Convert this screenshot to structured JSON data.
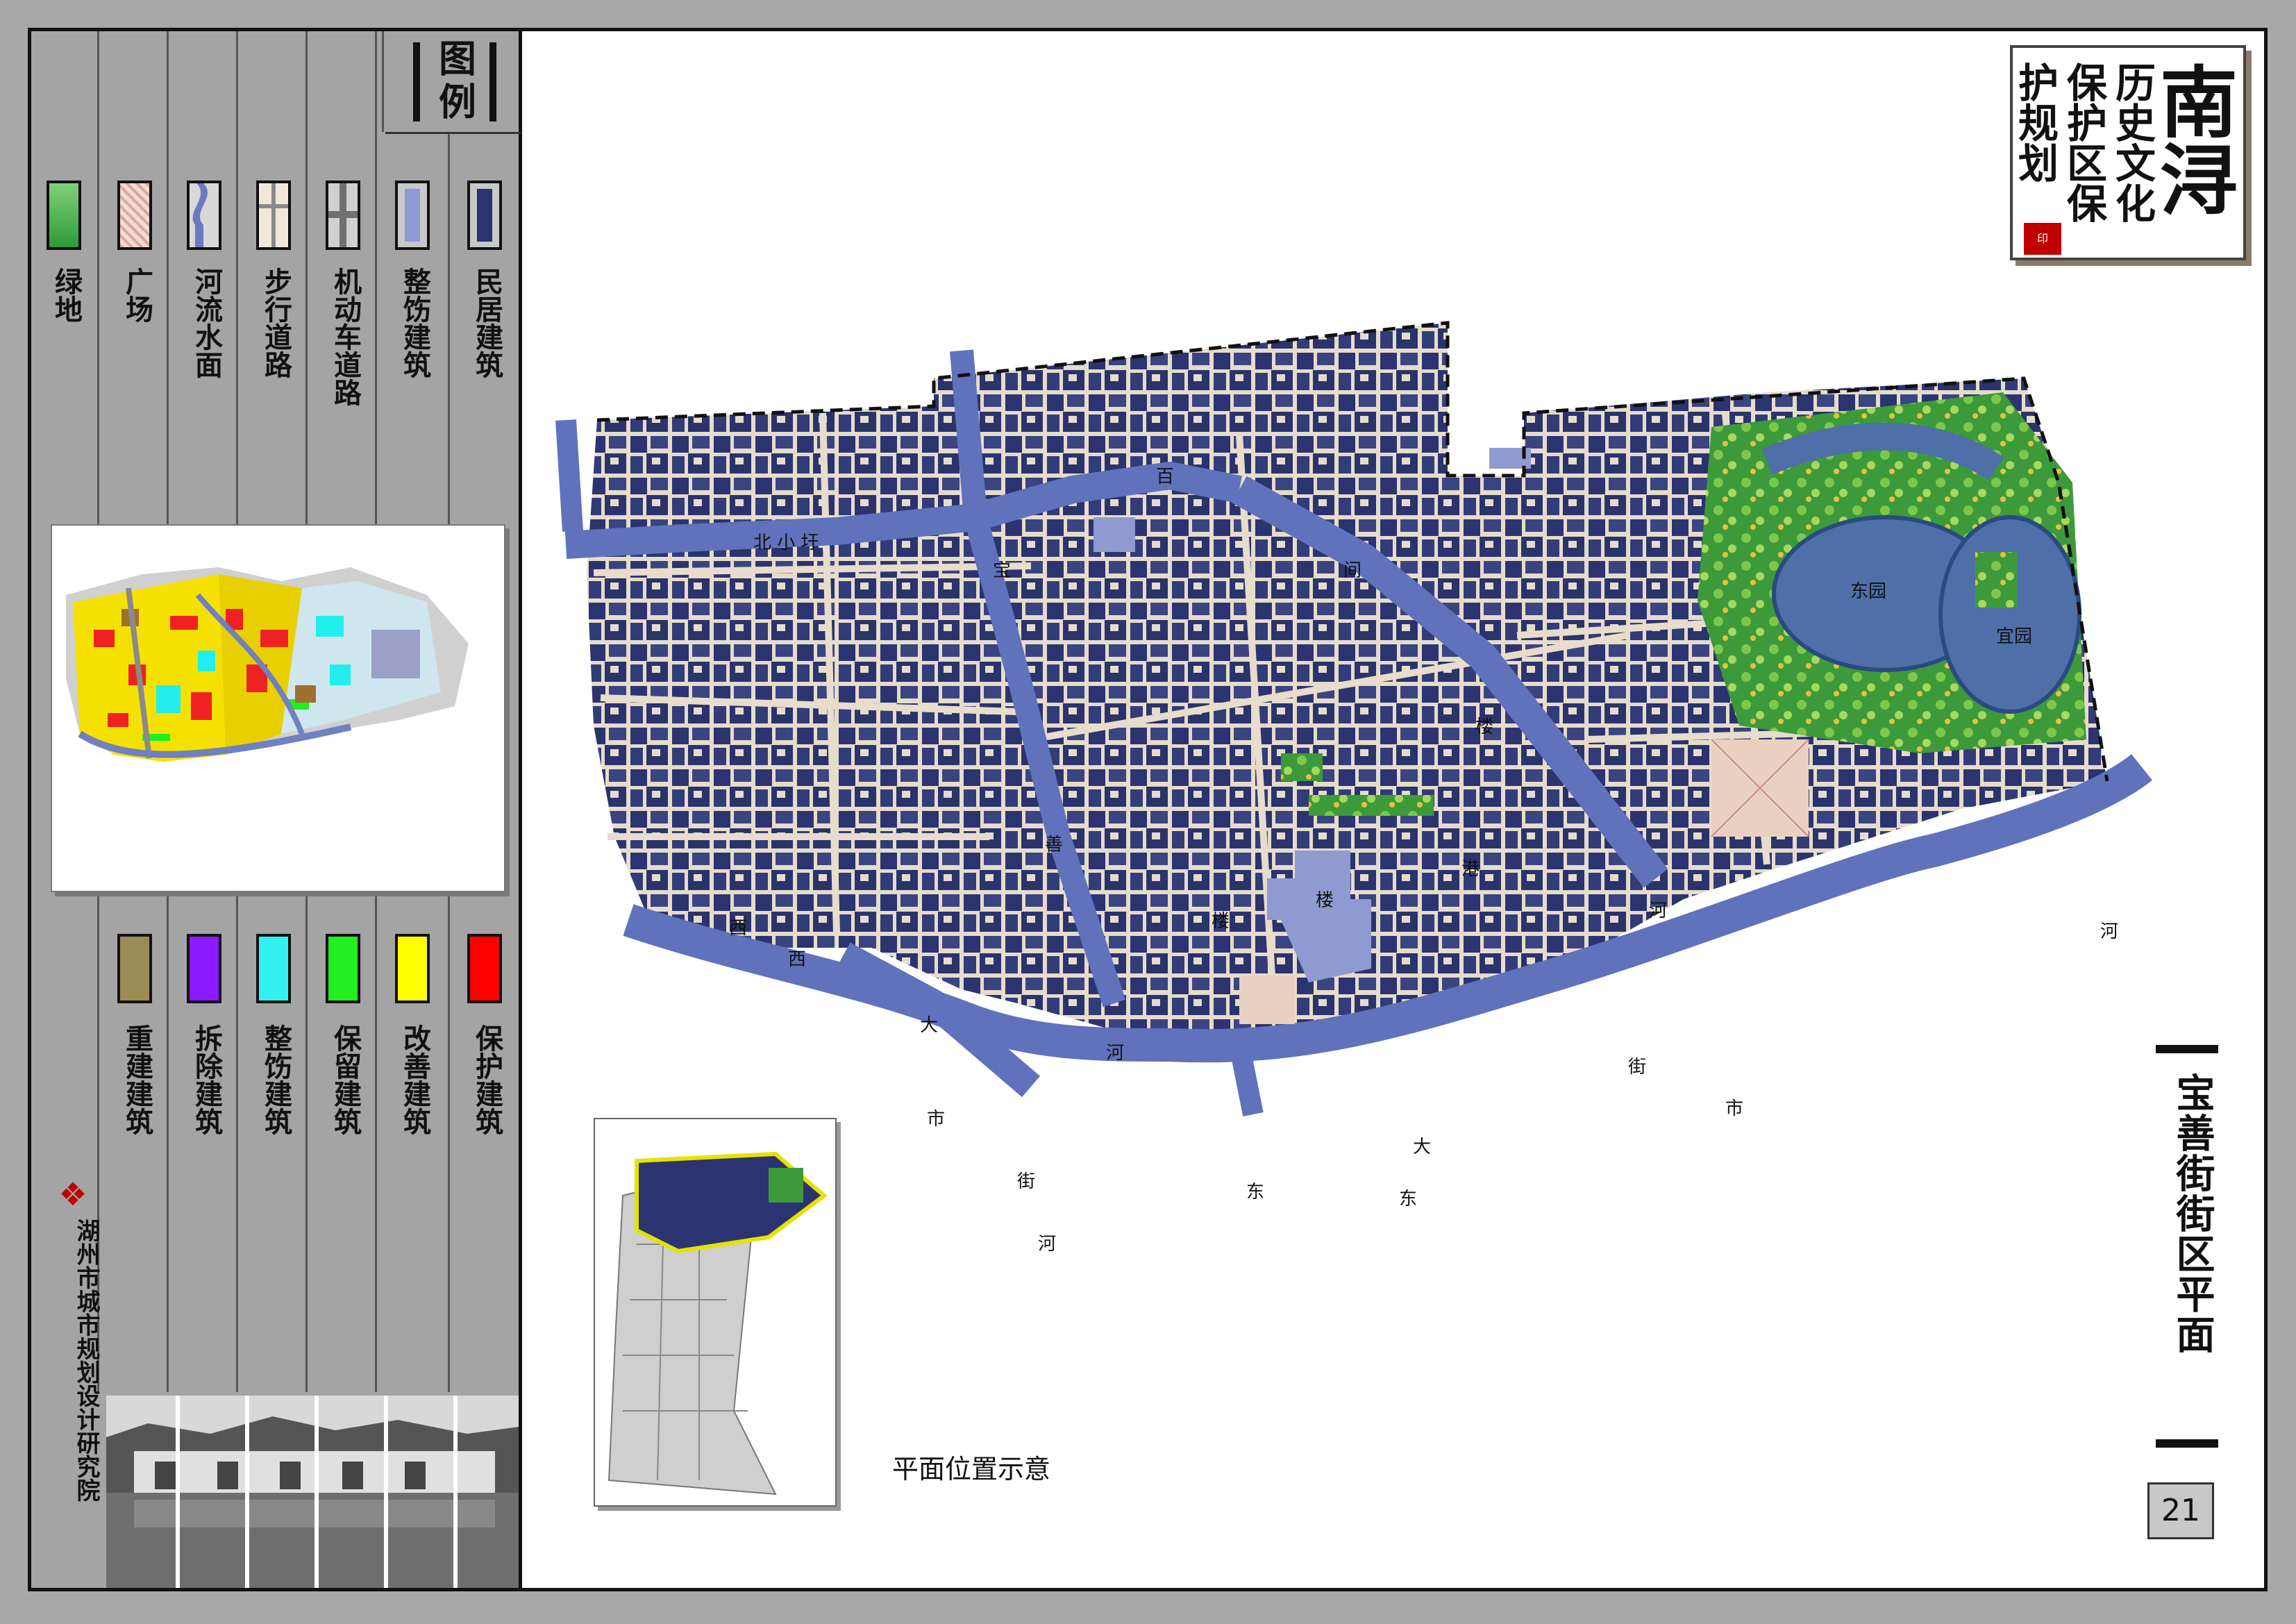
{
  "legend": {
    "title": "图例",
    "top_items": [
      {
        "label": "绿地",
        "color": "#3fa84a",
        "icon": "green-space-swatch"
      },
      {
        "label": "广场",
        "color": "#e9c8b8",
        "icon": "plaza-swatch"
      },
      {
        "label": "河流水面",
        "color": "#6a7bc0",
        "icon": "river-swatch"
      },
      {
        "label": "步行道路",
        "color": "#e8dccb",
        "icon": "walkway-swatch"
      },
      {
        "label": "机动车道路",
        "color": "#9a9a9a",
        "icon": "road-swatch"
      },
      {
        "label": "整饬建筑",
        "color": "#8e9ad0",
        "icon": "renovated-building-swatch"
      },
      {
        "label": "民居建筑",
        "color": "#2b3470",
        "icon": "residential-building-swatch"
      }
    ],
    "bottom_items": [
      {
        "label": "重建建筑",
        "color": "#9c8b55"
      },
      {
        "label": "拆除建筑",
        "color": "#8b1aff"
      },
      {
        "label": "整饬建筑",
        "color": "#33f0f0"
      },
      {
        "label": "保留建筑",
        "color": "#22ee22"
      },
      {
        "label": "改善建筑",
        "color": "#ffff00"
      },
      {
        "label": "保护建筑",
        "color": "#ff0000"
      }
    ],
    "institute": "湖州市城市规划设计研究院"
  },
  "title_block": {
    "main": "南浔",
    "columns": [
      "历史文化",
      "保护区保",
      "护规划"
    ]
  },
  "map": {
    "labels": {
      "beixiaoyu": "北 小 圩",
      "bai": "百",
      "jian": "间",
      "lou": "楼",
      "bao": "宝",
      "dongyuan": "东园",
      "yiyuan": "宜园",
      "xi1": "西",
      "xi2": "西",
      "da1": "大",
      "shi1": "市",
      "jie1": "街",
      "he1": "河",
      "he2": "河",
      "he3": "河",
      "he4": "河",
      "shan": "善",
      "gang": "港",
      "lou2": "楼",
      "lou3": "楼",
      "dong1": "东",
      "dong2": "东",
      "da2": "大",
      "jie2": "街",
      "shi2": "市"
    }
  },
  "location_caption": "平面位置示意",
  "sheet_title": "宝善街街区平面",
  "page_number": "21"
}
